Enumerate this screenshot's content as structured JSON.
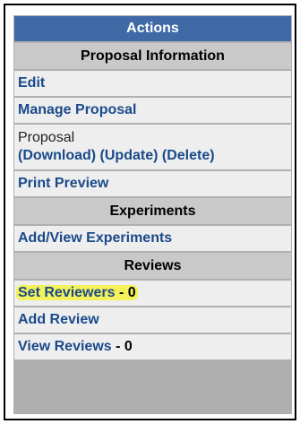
{
  "actions": {
    "title": "Actions",
    "proposal_section": {
      "heading": "Proposal Information",
      "edit_label": "Edit",
      "manage_label": "Manage Proposal",
      "proposal_label": "Proposal",
      "download_label": "(Download)",
      "update_label": "(Update)",
      "delete_label": "(Delete)",
      "print_preview_label": "Print Preview"
    },
    "experiments_section": {
      "heading": "Experiments",
      "add_view_label": "Add/View Experiments"
    },
    "reviews_section": {
      "heading": "Reviews",
      "set_reviewers_label": "Set Reviewers",
      "set_reviewers_count": " - 0",
      "add_review_label": "Add Review",
      "view_reviews_label": "View Reviews",
      "view_reviews_count": " - 0"
    }
  },
  "colors": {
    "header_bg": "#3f6aa6",
    "section_bg": "#c9c9c9",
    "row_bg": "#eeeeee",
    "link": "#1a4a8a",
    "highlight": "#f3f25a"
  }
}
